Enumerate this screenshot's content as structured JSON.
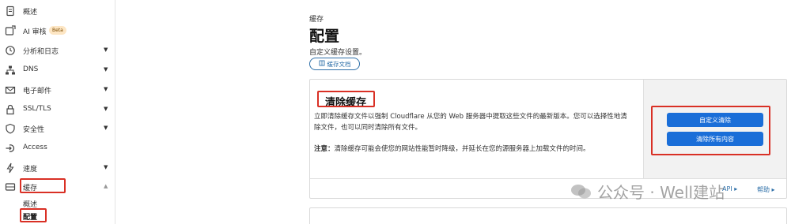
{
  "sidebar": {
    "items": [
      {
        "label": "概述",
        "icon": "document-icon",
        "has_caret": false
      },
      {
        "label": "AI 审核",
        "icon": "ai-audit-icon",
        "badge": "Beta",
        "has_caret": false
      },
      {
        "label": "分析和日志",
        "icon": "clock-icon",
        "has_caret": true
      },
      {
        "label": "DNS",
        "icon": "network-icon",
        "has_caret": true
      },
      {
        "label": "电子邮件",
        "icon": "email-icon",
        "has_caret": true
      },
      {
        "label": "SSL/TLS",
        "icon": "lock-icon",
        "has_caret": true
      },
      {
        "label": "安全性",
        "icon": "shield-icon",
        "has_caret": true
      },
      {
        "label": "Access",
        "icon": "access-icon",
        "has_caret": false
      },
      {
        "label": "速度",
        "icon": "bolt-icon",
        "has_caret": true
      },
      {
        "label": "缓存",
        "icon": "cache-icon",
        "has_caret": true,
        "expanded": true
      }
    ],
    "sub_items": [
      {
        "label": "概述"
      },
      {
        "label": "配置",
        "active": true
      }
    ]
  },
  "header": {
    "breadcrumb": "缓存",
    "title": "配置",
    "description": "自定义缓存设置。",
    "doc_button": "缓存文档"
  },
  "purge": {
    "title": "清除缓存",
    "body": "立即清除缓存文件以强制 Cloudflare 从您的 Web 服务器中提取这些文件的最新版本。您可以选择性地清除文件，也可以同时清除所有文件。",
    "note_label": "注意：",
    "note_text": "清除缓存可能会使您的网站性能暂时降级，并延长在您的源服务器上加载文件的时间。",
    "custom_purge_button": "自定义清除",
    "purge_all_button": "清除所有内容",
    "api_link": "API",
    "help_link": "帮助"
  },
  "watermark": {
    "text": "公众号 · Well建站"
  },
  "colors": {
    "accent": "#1a6ed8",
    "link": "#2d6fa8",
    "highlight": "#d93025",
    "badge_bg": "#fde6c4"
  }
}
